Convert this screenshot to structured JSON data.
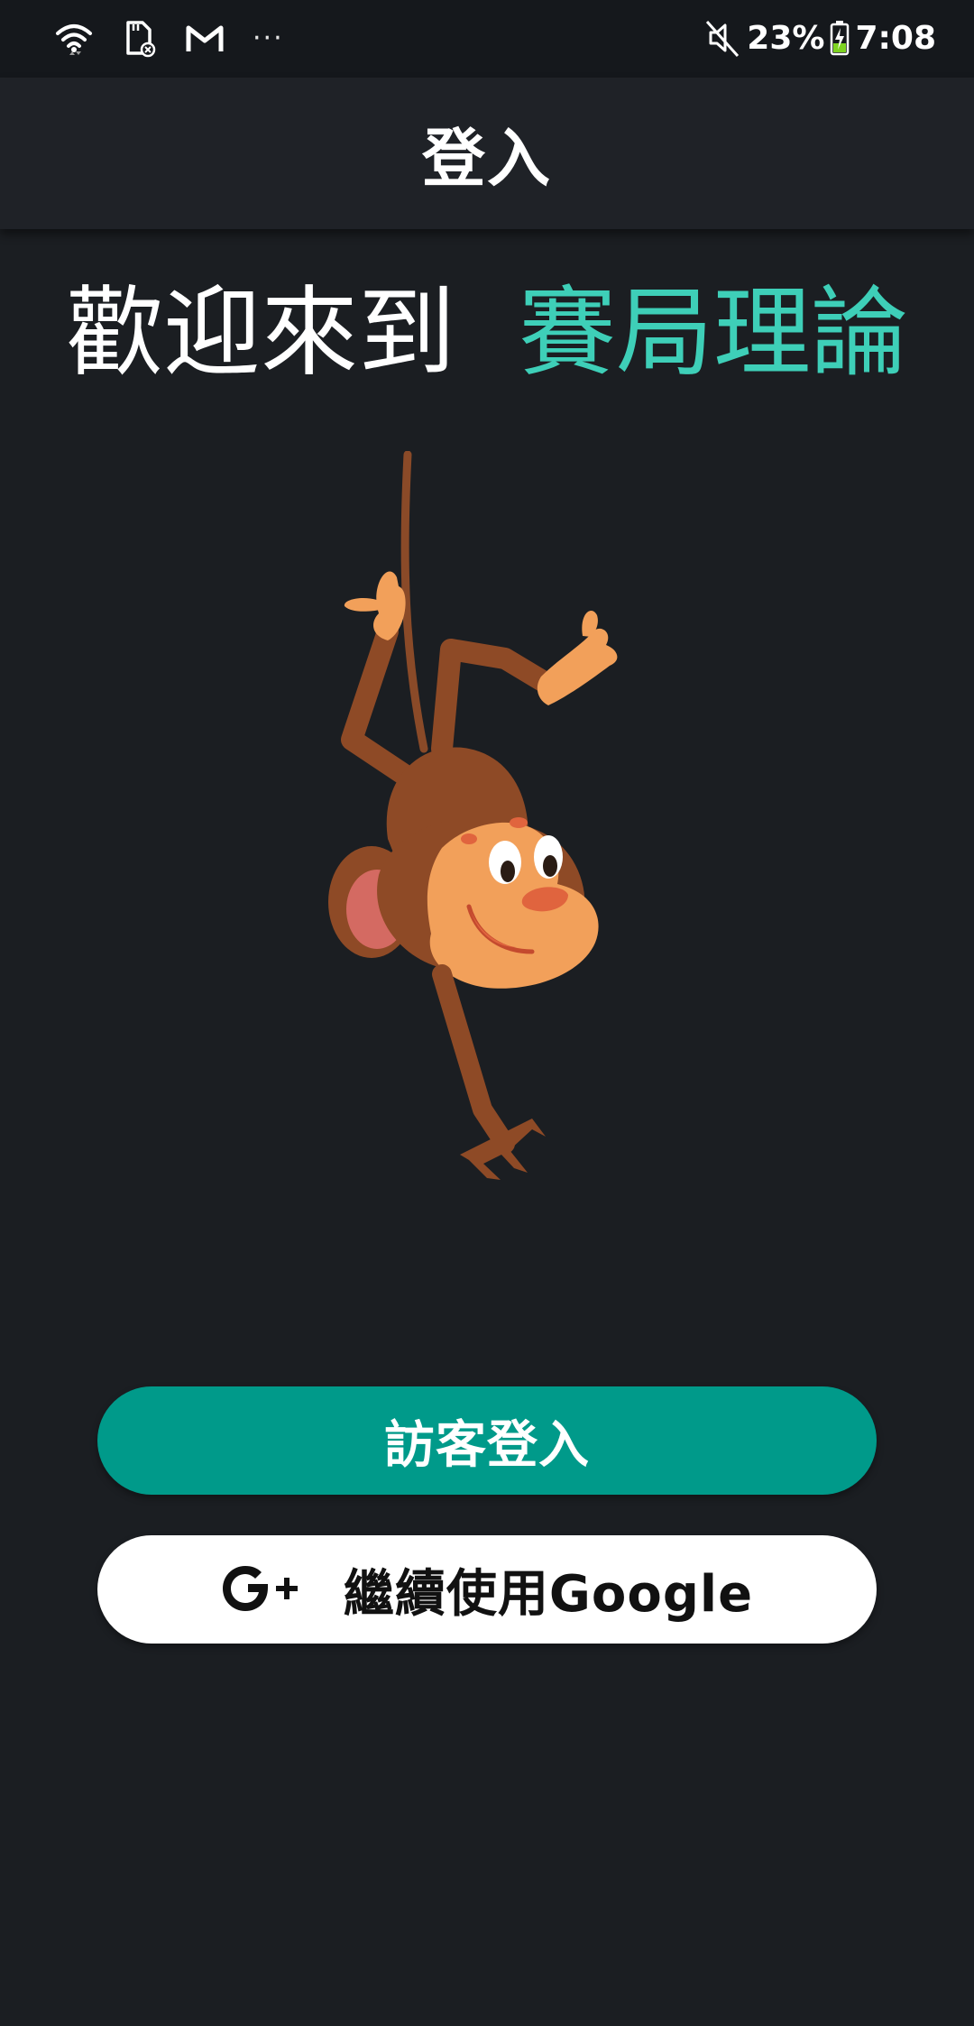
{
  "status_bar": {
    "battery_percent": "23%",
    "time": "7:08",
    "more_indicator": "···",
    "icons": [
      "wifi-icon",
      "sd-card-icon",
      "gmail-icon",
      "mute-icon",
      "battery-charging-icon"
    ]
  },
  "app_bar": {
    "title": "登入"
  },
  "welcome": {
    "prefix": "歡迎來到",
    "app_name": "賽局理論"
  },
  "buttons": {
    "guest_login": "訪客登入",
    "google_login": "繼續使用Google"
  },
  "colors": {
    "background": "#1b1e22",
    "accent": "#3ecfb8",
    "primary_button": "#009a8a"
  }
}
